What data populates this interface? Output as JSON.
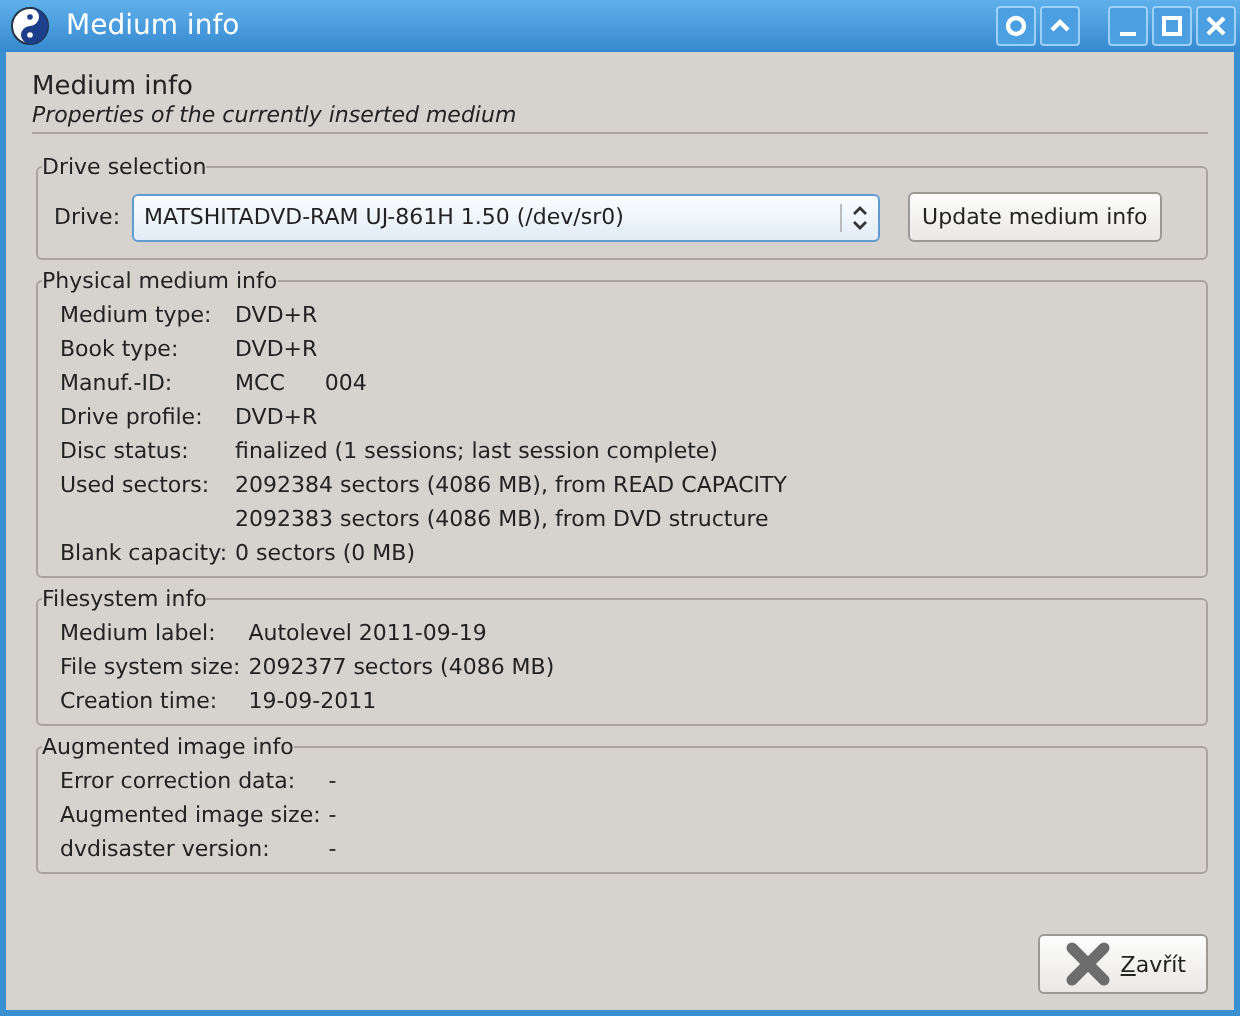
{
  "window": {
    "title": "Medium info"
  },
  "header": {
    "title": "Medium info",
    "subtitle": "Properties of the currently inserted medium"
  },
  "drive_selection": {
    "title": "Drive selection",
    "label": "Drive:",
    "value": "MATSHITADVD-RAM UJ-861H 1.50 (/dev/sr0)",
    "button": "Update medium info"
  },
  "groups": [
    {
      "title": "Physical medium info",
      "rows": [
        {
          "label": "Medium type:",
          "kind": "lines",
          "values": [
            "DVD+R"
          ]
        },
        {
          "label": "Book type:",
          "kind": "lines",
          "values": [
            "DVD+R"
          ]
        },
        {
          "label": "Manuf.-ID:",
          "kind": "inline",
          "values": [
            "MCC",
            "004"
          ]
        },
        {
          "label": "Drive profile:",
          "kind": "lines",
          "values": [
            "DVD+R"
          ]
        },
        {
          "label": "Disc status:",
          "kind": "lines",
          "values": [
            "finalized (1 sessions; last session complete)"
          ]
        },
        {
          "label": "Used sectors:",
          "kind": "lines",
          "values": [
            "2092384 sectors (4086 MB), from READ CAPACITY",
            "2092383 sectors (4086 MB), from DVD structure"
          ]
        },
        {
          "label": "Blank capacity:",
          "kind": "lines",
          "values": [
            "0 sectors (0 MB)"
          ]
        }
      ]
    },
    {
      "title": "Filesystem info",
      "rows": [
        {
          "label": "Medium label:",
          "kind": "lines",
          "values": [
            "Autolevel 2011-09-19"
          ]
        },
        {
          "label": "File system size:",
          "kind": "lines",
          "values": [
            "2092377 sectors (4086 MB)"
          ]
        },
        {
          "label": "Creation time:",
          "kind": "lines",
          "values": [
            "19-09-2011"
          ]
        }
      ]
    },
    {
      "title": "Augmented image info",
      "rows": [
        {
          "label": "Error correction data:",
          "kind": "lines",
          "values": [
            "-"
          ]
        },
        {
          "label": "Augmented image size:",
          "kind": "lines",
          "values": [
            "-"
          ]
        },
        {
          "label": "dvdisaster version:",
          "kind": "lines",
          "values": [
            "-"
          ]
        }
      ]
    }
  ],
  "close_button": "Zavřít"
}
